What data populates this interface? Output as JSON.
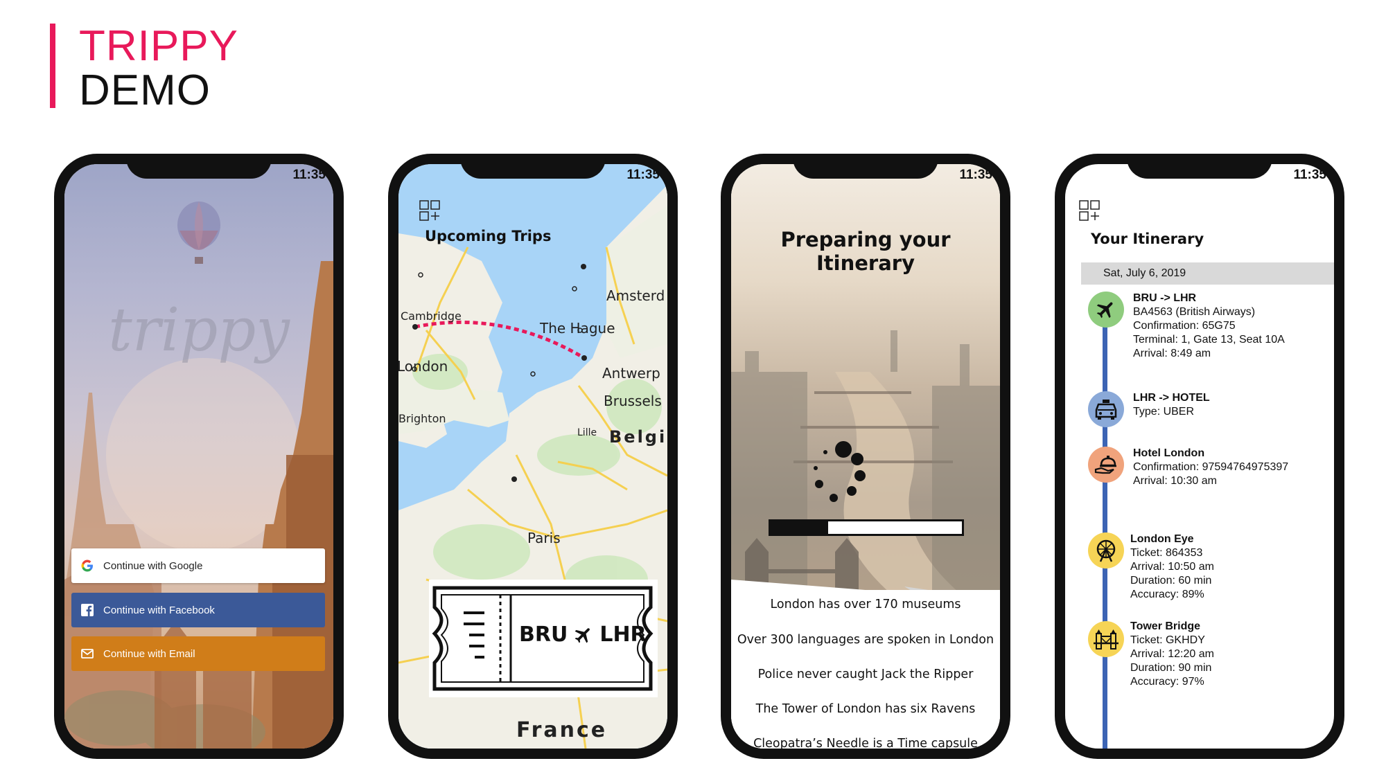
{
  "header": {
    "title": "TRIPPY",
    "subtitle": "DEMO"
  },
  "colors": {
    "accent": "#e8195a",
    "facebook": "#3b5998",
    "email": "#d07d19",
    "route": "#e8195a",
    "timeline": "#3c64b4"
  },
  "status_bar": {
    "time": "11:35"
  },
  "login_screen": {
    "brand": "trippy",
    "buttons": {
      "google": "Continue with Google",
      "facebook": "Continue with Facebook",
      "email": "Continue with Email"
    }
  },
  "trips_screen": {
    "title": "Upcoming Trips",
    "map_labels": {
      "amsterdam": "Amsterd",
      "the_hague": "The Hague",
      "cambridge": "Cambridge",
      "london": "London",
      "antwerp": "Antwerp",
      "brussels": "Brussels",
      "brighton": "Brighton",
      "lille": "Lille",
      "belgium": "Belgiu",
      "paris": "Paris",
      "france": "France"
    },
    "ticket": {
      "from": "BRU",
      "to": "LHR"
    }
  },
  "loading_screen": {
    "title": "Preparing your Itinerary",
    "progress": 0.3,
    "facts": [
      "London has over 170 museums",
      "Over 300 languages are spoken in London",
      "Police never caught Jack the Ripper",
      "The Tower of London has six Ravens",
      "Cleopatra’s Needle is a Time capsule"
    ]
  },
  "itinerary_screen": {
    "title": "Your Itinerary",
    "date": "Sat, July 6, 2019",
    "stops": {
      "flight": {
        "title": "BRU -> LHR",
        "lines": [
          "BA4563 (British Airways)",
          "Confirmation: 65G75",
          "Terminal: 1, Gate 13, Seat 10A",
          "Arrival: 8:49 am"
        ]
      },
      "taxi": {
        "title": "LHR -> HOTEL",
        "lines": [
          "Type: UBER"
        ]
      },
      "hotel": {
        "title": "Hotel London",
        "lines": [
          "Confirmation: 97594764975397",
          "Arrival: 10:30 am"
        ]
      },
      "eye": {
        "title": "London Eye",
        "lines": [
          "Ticket: 864353",
          "Arrival: 10:50 am",
          "Duration: 60 min",
          "Accuracy: 89%"
        ]
      },
      "bridge": {
        "title": "Tower Bridge",
        "lines": [
          "Ticket: GKHDY",
          "Arrival: 12:20 am",
          "Duration: 90 min",
          "Accuracy: 97%"
        ]
      }
    }
  }
}
